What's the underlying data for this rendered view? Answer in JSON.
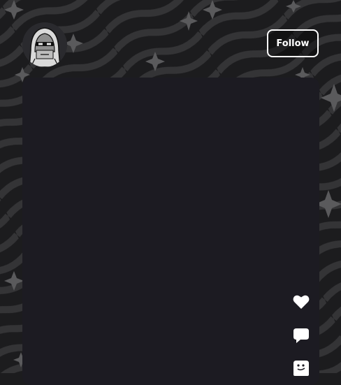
{
  "header": {
    "follow_label": "Follow"
  },
  "avatar": {
    "icon": "hooded-figure-icon"
  },
  "actions": [
    {
      "name": "like",
      "icon": "heart-icon"
    },
    {
      "name": "comment",
      "icon": "comment-bubble-icon"
    },
    {
      "name": "share",
      "icon": "share-face-icon"
    }
  ],
  "colors": {
    "background": "#1c1c1e",
    "pattern": "#3a3a3c",
    "card": "#1c1b22",
    "accent": "#ffffff"
  }
}
